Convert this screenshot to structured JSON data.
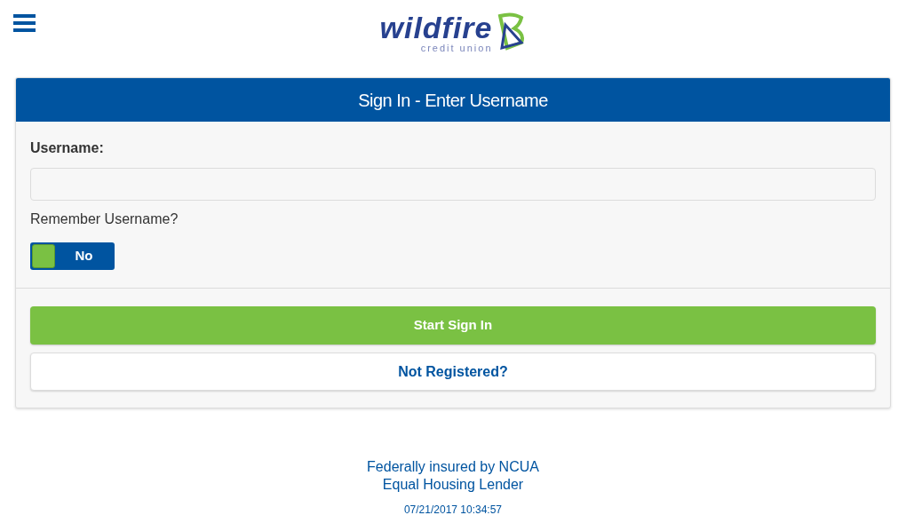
{
  "logo": {
    "name": "wildfire",
    "tagline": "credit union"
  },
  "card": {
    "title": "Sign In - Enter Username",
    "username": {
      "label": "Username:"
    },
    "remember": {
      "label": "Remember Username?",
      "on": false,
      "state_text": "No"
    },
    "buttons": [
      {
        "kind": "primary",
        "label": "Start Sign In"
      },
      {
        "kind": "secondary",
        "label": "Not Registered?"
      }
    ]
  },
  "footer": {
    "lines": [
      "Federally insured by NCUA",
      "Equal Housing Lender"
    ],
    "timestamp": "07/21/2017 10:34:57"
  }
}
